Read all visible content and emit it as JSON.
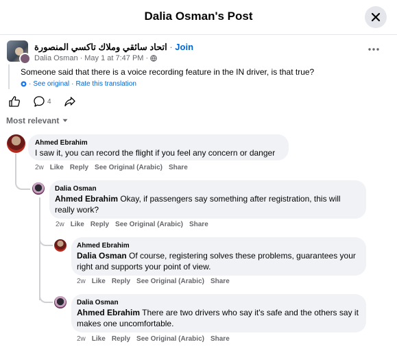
{
  "header": {
    "title": "Dalia Osman's Post"
  },
  "post": {
    "group_name": "اتحاد سائقي وملاك تاكسي المنصورة",
    "join_label": "Join",
    "author": "Dalia Osman",
    "time": "May 1 at 7:47 PM",
    "privacy_icon": "globe-icon",
    "text": "Someone said that there is a voice recording feature in the IN driver, is that true?",
    "see_original": "See original",
    "rate_translation": "Rate this translation",
    "comment_count": "4"
  },
  "sort": {
    "label": "Most relevant"
  },
  "comments": [
    {
      "name": "Ahmed Ebrahim",
      "mention": "",
      "text": "I saw it, you can record the flight if you feel any concern or danger",
      "time": "2w",
      "like": "Like",
      "reply": "Reply",
      "see_original": "See Original (Arabic)",
      "share": "Share"
    },
    {
      "name": "Dalia Osman",
      "mention": "Ahmed Ebrahim",
      "text": " Okay, if passengers say something after registration, this will really work?",
      "time": "2w",
      "like": "Like",
      "reply": "Reply",
      "see_original": "See Original (Arabic)",
      "share": "Share"
    },
    {
      "name": "Ahmed Ebrahim",
      "mention": "Dalia Osman",
      "text": " Of course, registering solves these problems, guarantees your right and supports your point of view.",
      "time": "2w",
      "like": "Like",
      "reply": "Reply",
      "see_original": "See Original (Arabic)",
      "share": "Share"
    },
    {
      "name": "Dalia Osman",
      "mention": "Ahmed Ebrahim",
      "text": " There are two drivers who say it's safe and the others say it makes one uncomfortable.",
      "time": "2w",
      "like": "Like",
      "reply": "Reply",
      "see_original": "See Original (Arabic)",
      "share": "Share"
    }
  ],
  "colors": {
    "link": "#0064d1",
    "muted": "#65676b",
    "bubble": "#f0f2f5",
    "thread_line": "#ced0d4"
  }
}
